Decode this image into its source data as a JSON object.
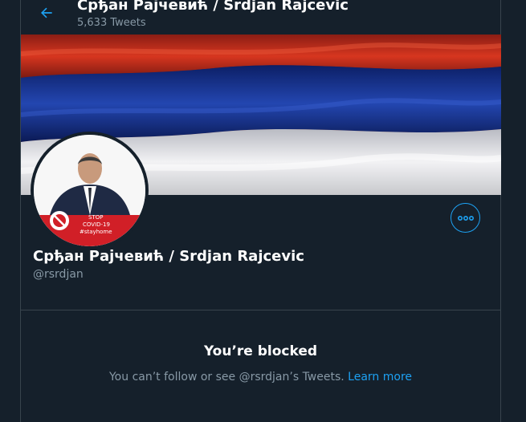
{
  "header": {
    "title": "Срђан Рајчевић / Srdjan Rajcevic",
    "tweet_count": "5,633 Tweets"
  },
  "profile": {
    "name": "Срђан Рајчевић / Srdjan Rajcevic",
    "handle": "@rsrdjan",
    "avatar_badge": {
      "line1": "STOP",
      "line2": "COVID-19",
      "line3": "#stayhome"
    }
  },
  "blocked": {
    "title": "You’re blocked",
    "message": "You can’t follow or see @rsrdjan’s Tweets.",
    "link": "Learn more"
  },
  "colors": {
    "background": "#15202b",
    "accent": "#1da1f2",
    "muted": "#8899a6",
    "border": "#38444d"
  },
  "icons": {
    "back": "arrow-left-icon",
    "more": "more-dots-icon"
  }
}
